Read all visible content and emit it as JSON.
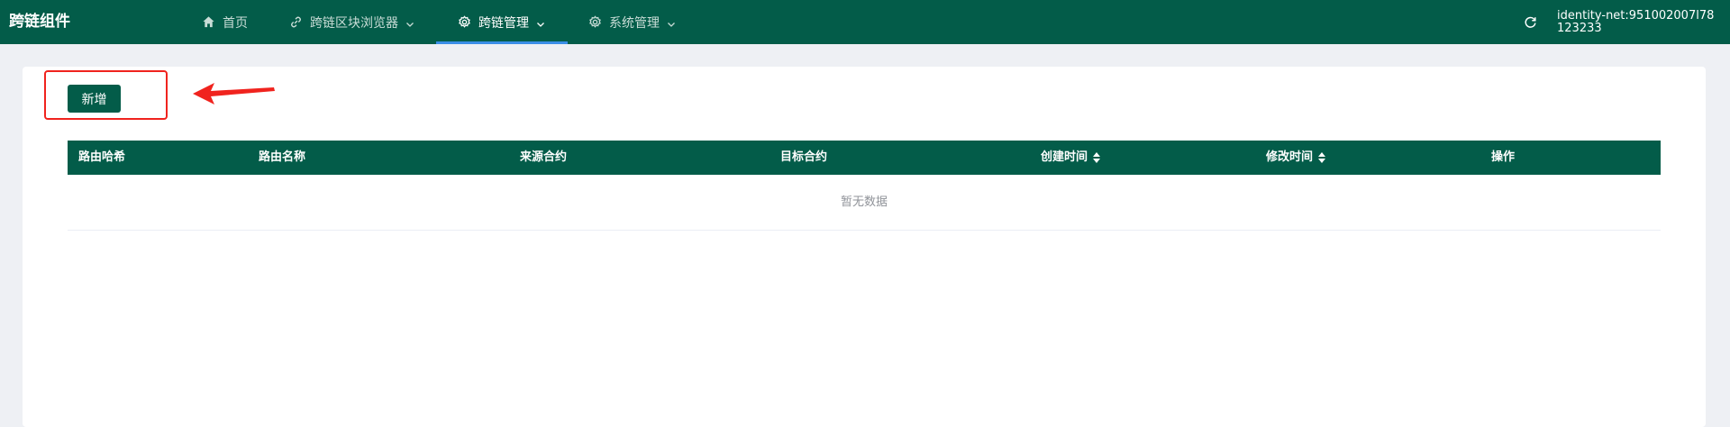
{
  "header": {
    "brand": "跨链组件",
    "nav": [
      {
        "label": "首页",
        "icon": "home-icon"
      },
      {
        "label": "跨链区块浏览器",
        "icon": "link-icon"
      },
      {
        "label": "跨链管理",
        "icon": "gear-icon"
      },
      {
        "label": "系统管理",
        "icon": "gear-icon"
      }
    ],
    "identity": "identity-net:951002007l78123233"
  },
  "toolbar": {
    "add_label": "新增"
  },
  "table": {
    "columns": [
      "路由哈希",
      "路由名称",
      "来源合约",
      "目标合约",
      "创建时间",
      "修改时间",
      "操作"
    ],
    "rows": [],
    "empty_text": "暂无数据"
  },
  "colors": {
    "primary": "#035c49",
    "active_underline": "#3a8ee6",
    "annotation": "#f0231e"
  }
}
